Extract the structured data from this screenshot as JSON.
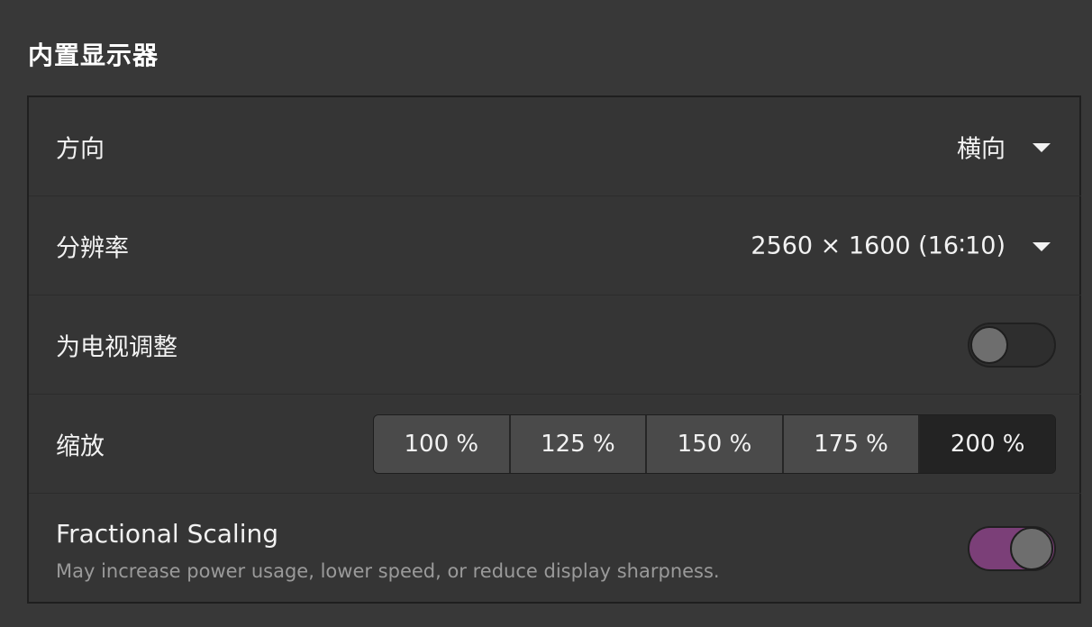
{
  "section": {
    "title": "内置显示器"
  },
  "rows": {
    "orientation": {
      "label": "方向",
      "value": "横向",
      "icon": "chevron-down-icon"
    },
    "resolution": {
      "label": "分辨率",
      "value": "2560 × 1600 (16∶10)",
      "icon": "chevron-down-icon"
    },
    "tv_adjust": {
      "label": "为电视调整",
      "enabled": false
    },
    "scale": {
      "label": "缩放",
      "options": [
        "100 %",
        "125 %",
        "150 %",
        "175 %",
        "200 %"
      ],
      "selected": "200 %"
    },
    "fractional": {
      "label": "Fractional Scaling",
      "description": "May increase power usage, lower speed, or reduce display sharpness.",
      "enabled": true
    }
  },
  "colors": {
    "background": "#383838",
    "panel": "#353535",
    "toggle_on": "#7b3f78",
    "selected_segment": "#232323"
  }
}
